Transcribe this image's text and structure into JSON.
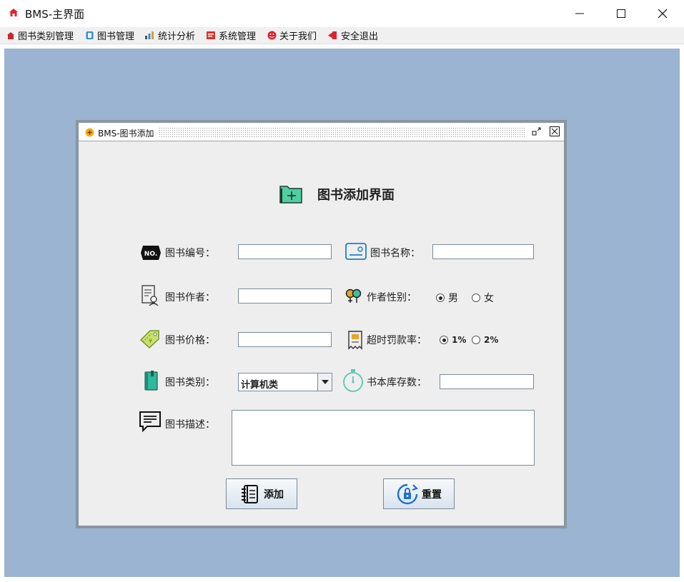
{
  "window": {
    "title": "BMS-主界面"
  },
  "menu": [
    {
      "id": "book-category",
      "label": "图书类别管理"
    },
    {
      "id": "book",
      "label": "图书管理"
    },
    {
      "id": "stats",
      "label": "统计分析"
    },
    {
      "id": "system",
      "label": "系统管理"
    },
    {
      "id": "about",
      "label": "关于我们"
    },
    {
      "id": "exit",
      "label": "安全退出"
    }
  ],
  "frame": {
    "title": "BMS-图书添加",
    "heading": "图书添加界面",
    "fields": {
      "book_no": {
        "label": "图书编号：",
        "value": ""
      },
      "book_name": {
        "label": "图书名称：",
        "value": ""
      },
      "author": {
        "label": "图书作者：",
        "value": ""
      },
      "author_gender": {
        "label": "作者性别：",
        "options": [
          "男",
          "女"
        ],
        "selected": "男"
      },
      "price": {
        "label": "图书价格：",
        "value": ""
      },
      "fine_rate": {
        "label": "超时罚款率：",
        "options": [
          "1%",
          "2%"
        ],
        "selected": "1%"
      },
      "category": {
        "label": "图书类别：",
        "value": "计算机类"
      },
      "stock": {
        "label": "书本库存数：",
        "value": ""
      },
      "description": {
        "label": "图书描述：",
        "value": ""
      }
    },
    "buttons": {
      "add": "添加",
      "reset": "重置"
    }
  },
  "colors": {
    "desktop": "#9ab4d2",
    "frame_border": "#8b95a0",
    "accent_green": "#3dbf9a"
  }
}
